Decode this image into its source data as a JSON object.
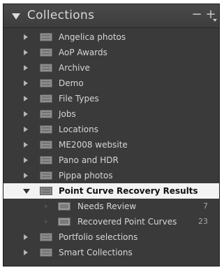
{
  "panel": {
    "title": "Collections",
    "minus_label": "−",
    "plus_label": "+"
  },
  "collections": [
    {
      "label": "Angelica photos"
    },
    {
      "label": "AoP Awards"
    },
    {
      "label": "Archive"
    },
    {
      "label": "Demo"
    },
    {
      "label": "File Types"
    },
    {
      "label": "Jobs"
    },
    {
      "label": "Locations"
    },
    {
      "label": "ME2008 website"
    },
    {
      "label": "Pano and HDR"
    },
    {
      "label": "Pippa photos"
    },
    {
      "label": "Point Curve Recovery Results",
      "selected": true,
      "expanded": true,
      "children": [
        {
          "label": "Needs Review",
          "count": "7"
        },
        {
          "label": "Recovered Point Curves",
          "count": "23"
        }
      ]
    },
    {
      "label": "Portfolio selections"
    },
    {
      "label": "Smart Collections"
    }
  ],
  "colors": {
    "panel_background": "#3a3a3a",
    "selected_row": "#f3f3f3",
    "text": "#d6d6d6",
    "selected_text": "#111111"
  },
  "icons": {
    "collapse": "disclosure-triangle-down-icon",
    "expand": "disclosure-triangle-right-icon",
    "collection_set": "collection-set-icon",
    "remove": "minus-icon",
    "add": "plus-icon"
  }
}
